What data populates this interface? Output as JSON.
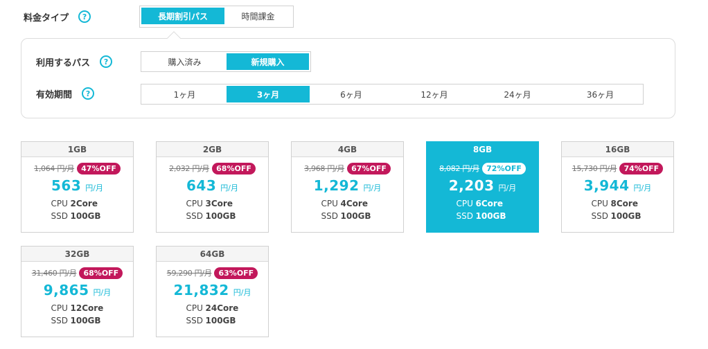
{
  "fee_type": {
    "label": "料金タイプ",
    "help": "?",
    "options": [
      {
        "label": "長期割引パス",
        "active": true
      },
      {
        "label": "時間課金",
        "active": false
      }
    ]
  },
  "pass": {
    "label": "利用するパス",
    "help": "?",
    "options": [
      {
        "label": "購入済み",
        "active": false
      },
      {
        "label": "新規購入",
        "active": true
      }
    ]
  },
  "period": {
    "label": "有効期間",
    "help": "?",
    "options": [
      {
        "label": "1ヶ月",
        "active": false
      },
      {
        "label": "3ヶ月",
        "active": true
      },
      {
        "label": "6ヶ月",
        "active": false
      },
      {
        "label": "12ヶ月",
        "active": false
      },
      {
        "label": "24ヶ月",
        "active": false
      },
      {
        "label": "36ヶ月",
        "active": false
      }
    ]
  },
  "plans": [
    {
      "name": "1GB",
      "orig": "1,064 円/月",
      "off": "47%OFF",
      "price": "563",
      "unit": "円/月",
      "cpu_k": "CPU",
      "cpu": "2Core",
      "ssd_k": "SSD",
      "ssd": "100GB",
      "selected": false
    },
    {
      "name": "2GB",
      "orig": "2,032 円/月",
      "off": "68%OFF",
      "price": "643",
      "unit": "円/月",
      "cpu_k": "CPU",
      "cpu": "3Core",
      "ssd_k": "SSD",
      "ssd": "100GB",
      "selected": false
    },
    {
      "name": "4GB",
      "orig": "3,968 円/月",
      "off": "67%OFF",
      "price": "1,292",
      "unit": "円/月",
      "cpu_k": "CPU",
      "cpu": "4Core",
      "ssd_k": "SSD",
      "ssd": "100GB",
      "selected": false
    },
    {
      "name": "8GB",
      "orig": "8,082 円/月",
      "off": "72%OFF",
      "price": "2,203",
      "unit": "円/月",
      "cpu_k": "CPU",
      "cpu": "6Core",
      "ssd_k": "SSD",
      "ssd": "100GB",
      "selected": true
    },
    {
      "name": "16GB",
      "orig": "15,730 円/月",
      "off": "74%OFF",
      "price": "3,944",
      "unit": "円/月",
      "cpu_k": "CPU",
      "cpu": "8Core",
      "ssd_k": "SSD",
      "ssd": "100GB",
      "selected": false
    },
    {
      "name": "32GB",
      "orig": "31,460 円/月",
      "off": "68%OFF",
      "price": "9,865",
      "unit": "円/月",
      "cpu_k": "CPU",
      "cpu": "12Core",
      "ssd_k": "SSD",
      "ssd": "100GB",
      "selected": false
    },
    {
      "name": "64GB",
      "orig": "59,290 円/月",
      "off": "63%OFF",
      "price": "21,832",
      "unit": "円/月",
      "cpu_k": "CPU",
      "cpu": "24Core",
      "ssd_k": "SSD",
      "ssd": "100GB",
      "selected": false
    }
  ],
  "colors": {
    "accent": "#14b8d6",
    "badge": "#c2185b"
  }
}
